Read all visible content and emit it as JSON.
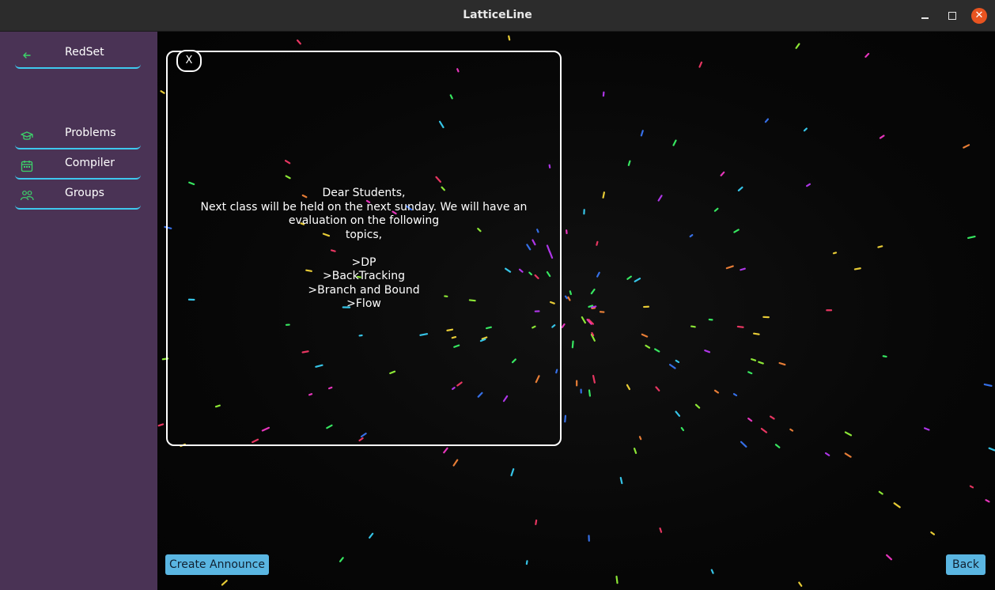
{
  "window": {
    "title": "LatticeLine"
  },
  "sidebar": {
    "header": {
      "label": "RedSet",
      "icon": "arrow-left-icon"
    },
    "items": [
      {
        "label": "Problems",
        "icon": "graduation-cap-icon"
      },
      {
        "label": "Compiler",
        "icon": "calendar-icon"
      },
      {
        "label": "Groups",
        "icon": "people-icon"
      }
    ],
    "accent_color": "#3ec8ee",
    "icon_color": "#3cd46a",
    "background_color": "#4a3355"
  },
  "announcement": {
    "close_label": "X",
    "text": "Dear Students,\nNext class will be held on the next sunday. We will have an\nevaluation on the following\ntopics,\n\n>DP\n>BackTracking\n>Branch and Bound\n>Flow"
  },
  "footer": {
    "create_label": "Create Announce",
    "back_label": "Back",
    "button_color": "#5ab6e2"
  }
}
